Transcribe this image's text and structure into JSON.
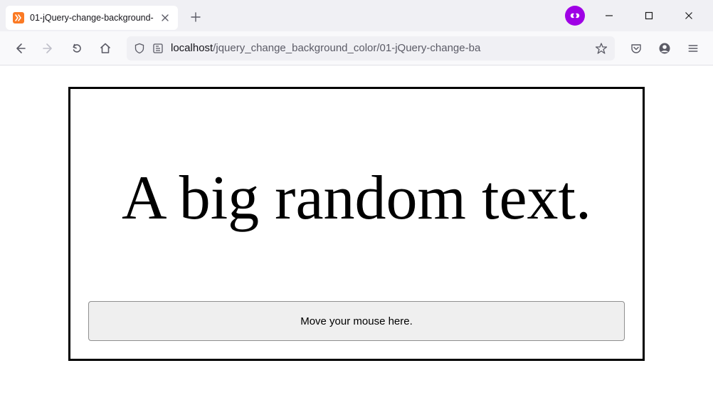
{
  "titlebar": {
    "tab_title": "01-jQuery-change-background-",
    "favicon": "xampp"
  },
  "toolbar": {
    "url_host": "localhost",
    "url_path": "/jquery_change_background_color/01-jQuery-change-ba"
  },
  "page": {
    "heading": "A big random text.",
    "button_label": "Move your mouse here."
  }
}
